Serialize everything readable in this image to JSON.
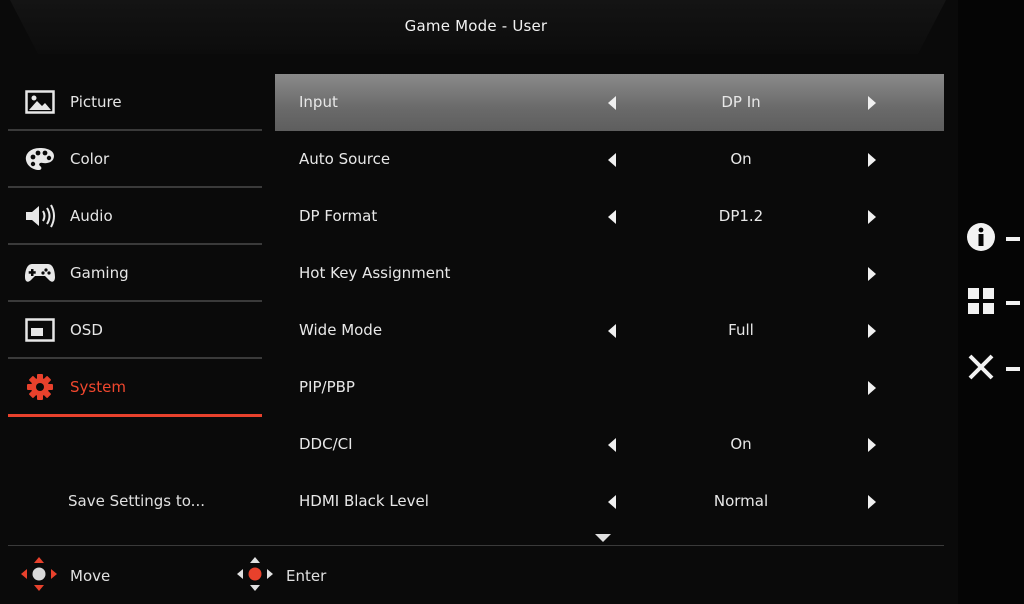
{
  "header": {
    "title": "Game Mode - User"
  },
  "sidebar": {
    "items": [
      {
        "label": "Picture",
        "icon": "picture-icon"
      },
      {
        "label": "Color",
        "icon": "palette-icon"
      },
      {
        "label": "Audio",
        "icon": "speaker-icon"
      },
      {
        "label": "Gaming",
        "icon": "gamepad-icon"
      },
      {
        "label": "OSD",
        "icon": "osd-window-icon"
      },
      {
        "label": "System",
        "icon": "gear-icon",
        "active": true
      }
    ],
    "save_label": "Save Settings to..."
  },
  "main": {
    "rows": [
      {
        "name": "Input",
        "value": "DP In",
        "selected": true
      },
      {
        "name": "Auto Source",
        "value": "On"
      },
      {
        "name": "DP Format",
        "value": "DP1.2"
      },
      {
        "name": "Hot Key Assignment",
        "value": ""
      },
      {
        "name": "Wide Mode",
        "value": "Full"
      },
      {
        "name": "PIP/PBP",
        "value": ""
      },
      {
        "name": "DDC/CI",
        "value": "On"
      },
      {
        "name": "HDMI Black Level",
        "value": "Normal"
      }
    ]
  },
  "footer": {
    "move_label": "Move",
    "enter_label": "Enter"
  },
  "colors": {
    "accent": "#e8412c",
    "background": "#0a0a0a",
    "selected_row": "#7a7a7a"
  }
}
